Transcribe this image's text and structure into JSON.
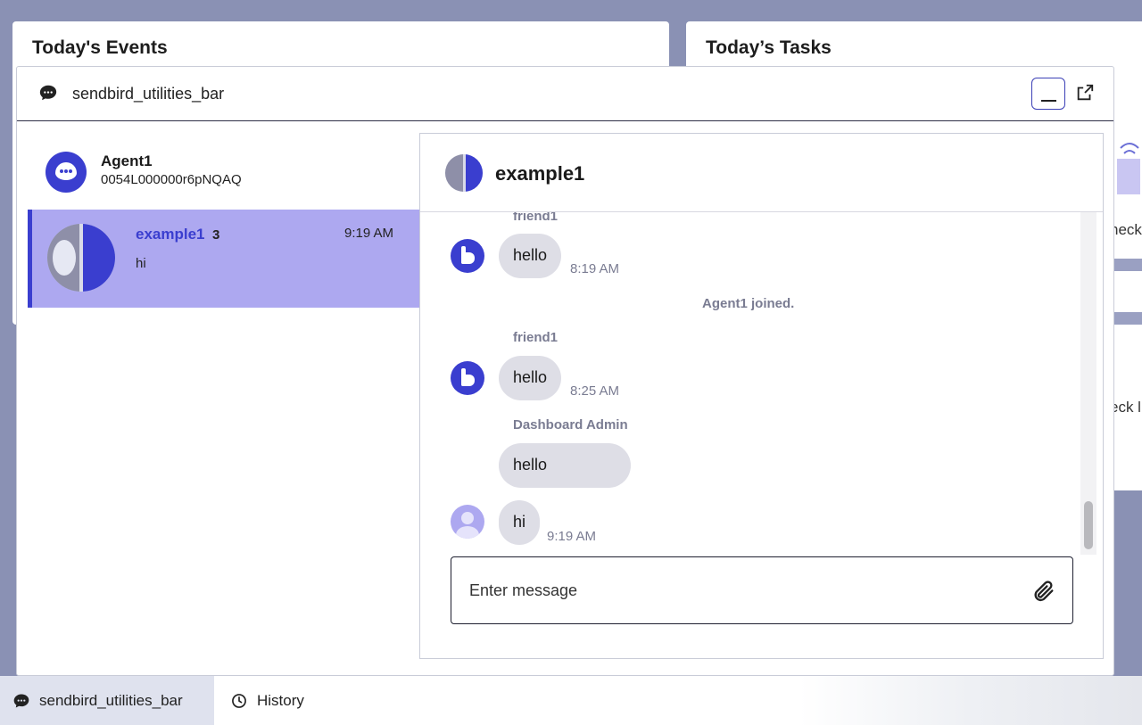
{
  "dashboard": {
    "events_title": "Today's Events",
    "tasks_title": "Today’s Tasks",
    "partial_text_1": "neck",
    "partial_text_2": "eck l"
  },
  "panel": {
    "title": "sendbird_utilities_bar",
    "minimize_icon": "minimize-icon",
    "popout_icon": "popout-icon"
  },
  "agent": {
    "name": "Agent1",
    "id": "0054L000000r6pNQAQ"
  },
  "channel_list": {
    "items": [
      {
        "name": "example1",
        "unread": "3",
        "time": "9:19 AM",
        "last_message": "hi"
      }
    ]
  },
  "conversation": {
    "title": "example1",
    "messages": [
      {
        "sender": "friend1",
        "text": "hello",
        "time": "8:19 AM"
      },
      {
        "system": "Agent1 joined."
      },
      {
        "sender": "friend1",
        "text": "hello",
        "time": "8:25 AM"
      },
      {
        "sender": "Dashboard Admin",
        "text": "hello",
        "time": ""
      },
      {
        "sender": "",
        "text": "hi",
        "time": "9:19 AM"
      }
    ],
    "input_placeholder": "Enter message"
  },
  "utility_bar": {
    "tabs": [
      {
        "label": "sendbird_utilities_bar",
        "icon": "chat-icon"
      },
      {
        "label": "History",
        "icon": "clock-icon"
      }
    ]
  },
  "colors": {
    "accent": "#3a3ecf",
    "selected_row": "#ada8f0",
    "bubble": "#dedee6",
    "meta_text": "#7a7c92"
  }
}
